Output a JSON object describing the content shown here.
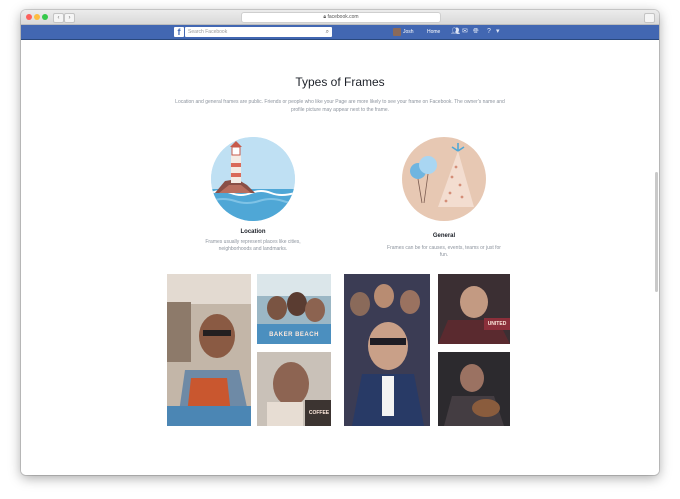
{
  "browser": {
    "url": "facebook.com"
  },
  "facebook_bar": {
    "logo": "f",
    "search_placeholder": "Search Facebook",
    "user_name": "Josh",
    "home_label": "Home"
  },
  "page": {
    "title": "Types of Frames",
    "intro": "Location and general frames are public. Friends or people who like your Page are more likely to see your frame on Facebook. The owner's name and profile picture may appear next to the frame."
  },
  "categories": [
    {
      "title": "Location",
      "description": "Frames usually represent places like cities, neighborhoods and landmarks."
    },
    {
      "title": "General",
      "description": "Frames can be for causes, events, teams or just for fun."
    }
  ],
  "photo_captions": {
    "baker_beach": "BAKER BEACH",
    "coffee": "COFFEE",
    "united": "UNITED"
  },
  "colors": {
    "facebook_blue": "#4267b2",
    "sky_blue": "#a7d3ee",
    "warm_beige": "#e7c8b3",
    "text_dark": "#1d2129",
    "text_muted": "#8d949e"
  }
}
